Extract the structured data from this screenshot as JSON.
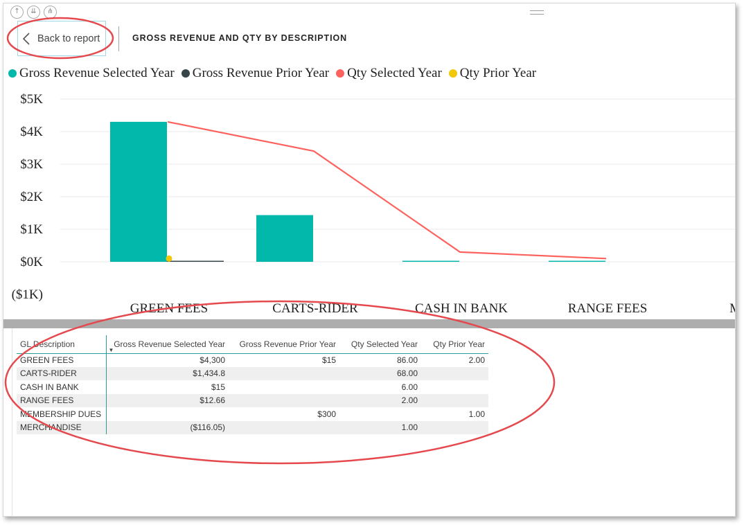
{
  "nav": {
    "back_label": "Back to report",
    "drill_up_icon": "drill-up-icon",
    "drill_down_icon": "drill-down-icon",
    "expand_icon": "expand-hierarchy-icon"
  },
  "page": {
    "title": "GROSS REVENUE AND QTY BY DESCRIPTION"
  },
  "legend": [
    {
      "label": "Gross Revenue Selected Year",
      "color": "#01b8aa"
    },
    {
      "label": "Gross Revenue Prior Year",
      "color": "#374649"
    },
    {
      "label": "Qty Selected Year",
      "color": "#fd625e"
    },
    {
      "label": "Qty Prior Year",
      "color": "#f2c80f"
    }
  ],
  "chart_data": {
    "type": "bar",
    "categories": [
      "GREEN FEES",
      "CARTS-RIDER",
      "CASH IN BANK",
      "RANGE FEES",
      "MEMBE"
    ],
    "y_ticks": [
      "$5K",
      "$4K",
      "$3K",
      "$2K",
      "$1K",
      "$0K",
      "($1K)"
    ],
    "ylim": [
      -1000,
      5000
    ],
    "grid": true,
    "legend_position": "top-left",
    "series": [
      {
        "name": "Gross Revenue Selected Year",
        "kind": "bar",
        "color": "#01b8aa",
        "values": [
          4300,
          1434.8,
          15,
          12.66
        ]
      },
      {
        "name": "Gross Revenue Prior Year",
        "kind": "bar",
        "color": "#374649",
        "values": [
          15,
          null,
          null,
          null
        ]
      },
      {
        "name": "Qty Selected Year",
        "kind": "line",
        "color": "#fd625e",
        "values": [
          86,
          68,
          6,
          2
        ]
      },
      {
        "name": "Qty Prior Year",
        "kind": "point",
        "color": "#f2c80f",
        "values": [
          2,
          null,
          null,
          null
        ]
      }
    ],
    "qty_axis_range": [
      -20,
      100
    ]
  },
  "table": {
    "columns": [
      "GL Description",
      "Gross Revenue Selected Year",
      "Gross Revenue Prior Year",
      "Qty Selected Year",
      "Qty Prior Year"
    ],
    "rows": [
      [
        "GREEN FEES",
        "$4,300",
        "$15",
        "86.00",
        "2.00"
      ],
      [
        "CARTS-RIDER",
        "$1,434.8",
        "",
        "68.00",
        ""
      ],
      [
        "CASH IN BANK",
        "$15",
        "",
        "6.00",
        ""
      ],
      [
        "RANGE FEES",
        "$12.66",
        "",
        "2.00",
        ""
      ],
      [
        "MEMBERSHIP DUES",
        "",
        "$300",
        "",
        "1.00"
      ],
      [
        "MERCHANDISE",
        "($116.05)",
        "",
        "1.00",
        ""
      ]
    ]
  }
}
